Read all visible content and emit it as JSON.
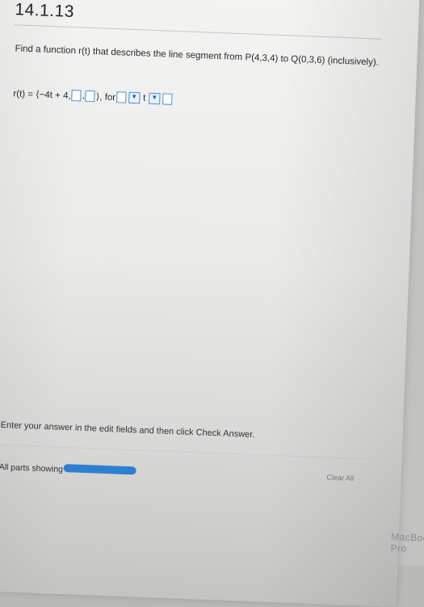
{
  "problem": {
    "number": "14.1.13",
    "question": "Find a function r(t) that describes the line segment from P(4,3,4) to Q(0,3,6) (inclusively).",
    "formula_prefix": "r(t) = ⟨−4t + 4,",
    "formula_comma": ",",
    "formula_close": "⟩, for",
    "t_var": "t",
    "dropdown_symbol": "▼"
  },
  "instructions": "Enter your answer in the edit fields and then click Check Answer.",
  "footer": {
    "parts_label": "All parts showing",
    "clear_all": "Clear All"
  },
  "device_brand": "MacBook Pro",
  "colors": {
    "accent": "#2f7fd1"
  }
}
